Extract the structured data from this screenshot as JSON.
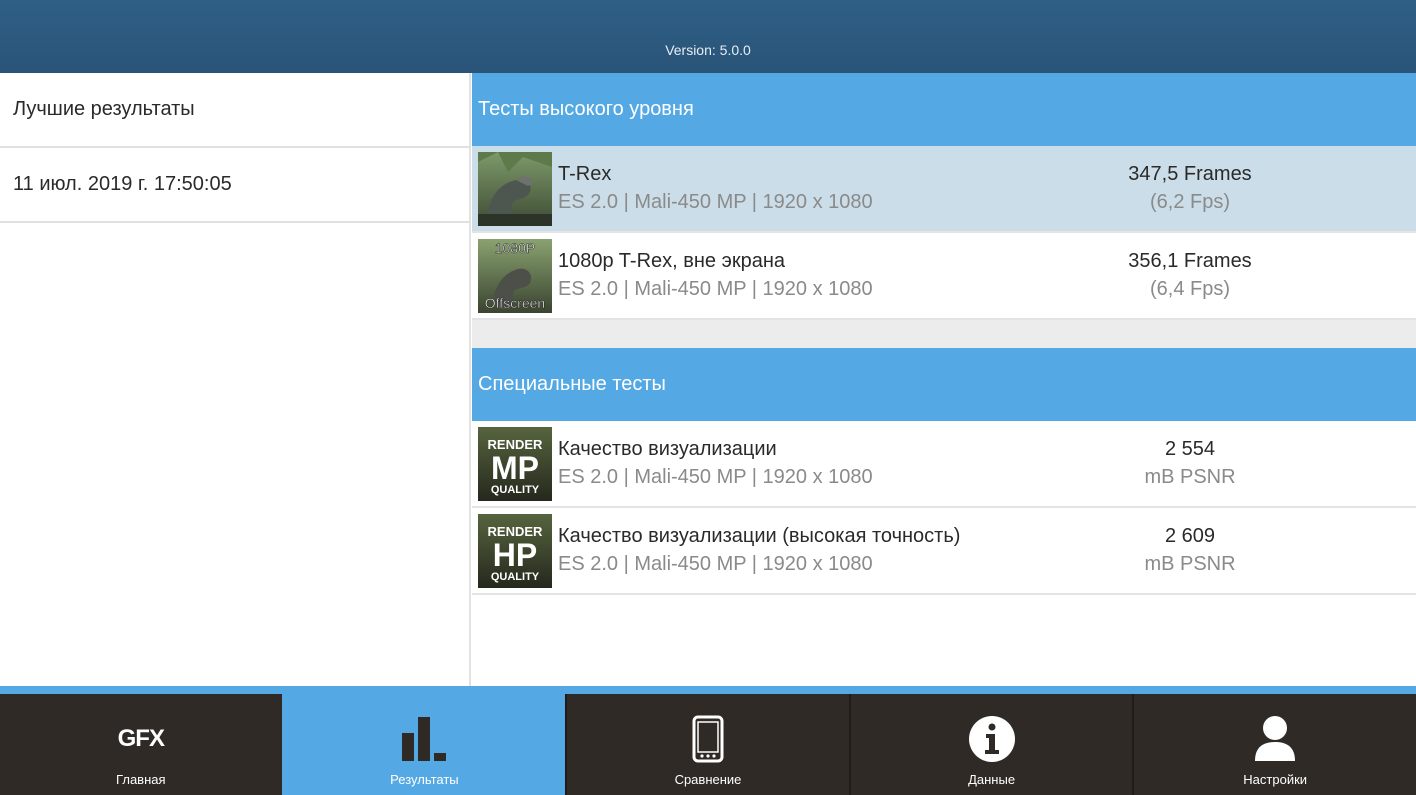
{
  "header": {
    "version": "Version: 5.0.0"
  },
  "left": {
    "title": "Лучшие результаты",
    "date": "11 июл. 2019 г. 17:50:05"
  },
  "sections": [
    {
      "title": "Тесты высокого уровня",
      "rows": [
        {
          "name": "T-Rex",
          "sub": "ES 2.0 | Mali-450 MP | 1920 x 1080",
          "value": "347,5 Frames",
          "unit": "(6,2 Fps)",
          "thumb": "trex-thumbnail"
        },
        {
          "name": "1080p T-Rex, вне экрана",
          "sub": "ES 2.0 | Mali-450 MP | 1920 x 1080",
          "value": "356,1 Frames",
          "unit": "(6,4 Fps)",
          "thumb": "trex-offscreen-thumbnail",
          "thumb_top": "1080P",
          "thumb_bottom": "Offscreen"
        }
      ]
    },
    {
      "title": "Специальные тесты",
      "rows": [
        {
          "name": "Качество визуализации",
          "sub": "ES 2.0 | Mali-450 MP | 1920 x 1080",
          "value": "2 554",
          "unit": "mB PSNR",
          "thumb": "render-quality-mp-thumbnail",
          "thumb_top": "RENDER",
          "thumb_mid": "MP",
          "thumb_bottom": "QUALITY"
        },
        {
          "name": "Качество визуализации (высокая точность)",
          "sub": "ES 2.0 | Mali-450 MP | 1920 x 1080",
          "value": "2 609",
          "unit": "mB PSNR",
          "thumb": "render-quality-hp-thumbnail",
          "thumb_top": "RENDER",
          "thumb_mid": "HP",
          "thumb_bottom": "QUALITY"
        }
      ]
    }
  ],
  "nav": [
    {
      "label": "Главная",
      "icon": "gfx-logo-icon",
      "icon_text": "GFX"
    },
    {
      "label": "Результаты",
      "icon": "bar-chart-icon",
      "active": true
    },
    {
      "label": "Сравнение",
      "icon": "phone-icon"
    },
    {
      "label": "Данные",
      "icon": "info-icon"
    },
    {
      "label": "Настройки",
      "icon": "user-icon"
    }
  ],
  "colors": {
    "topbar": "#2a5478",
    "accent": "#54a8e4",
    "nav_bg": "#2f2a26",
    "selected_row": "#cbdde8"
  }
}
